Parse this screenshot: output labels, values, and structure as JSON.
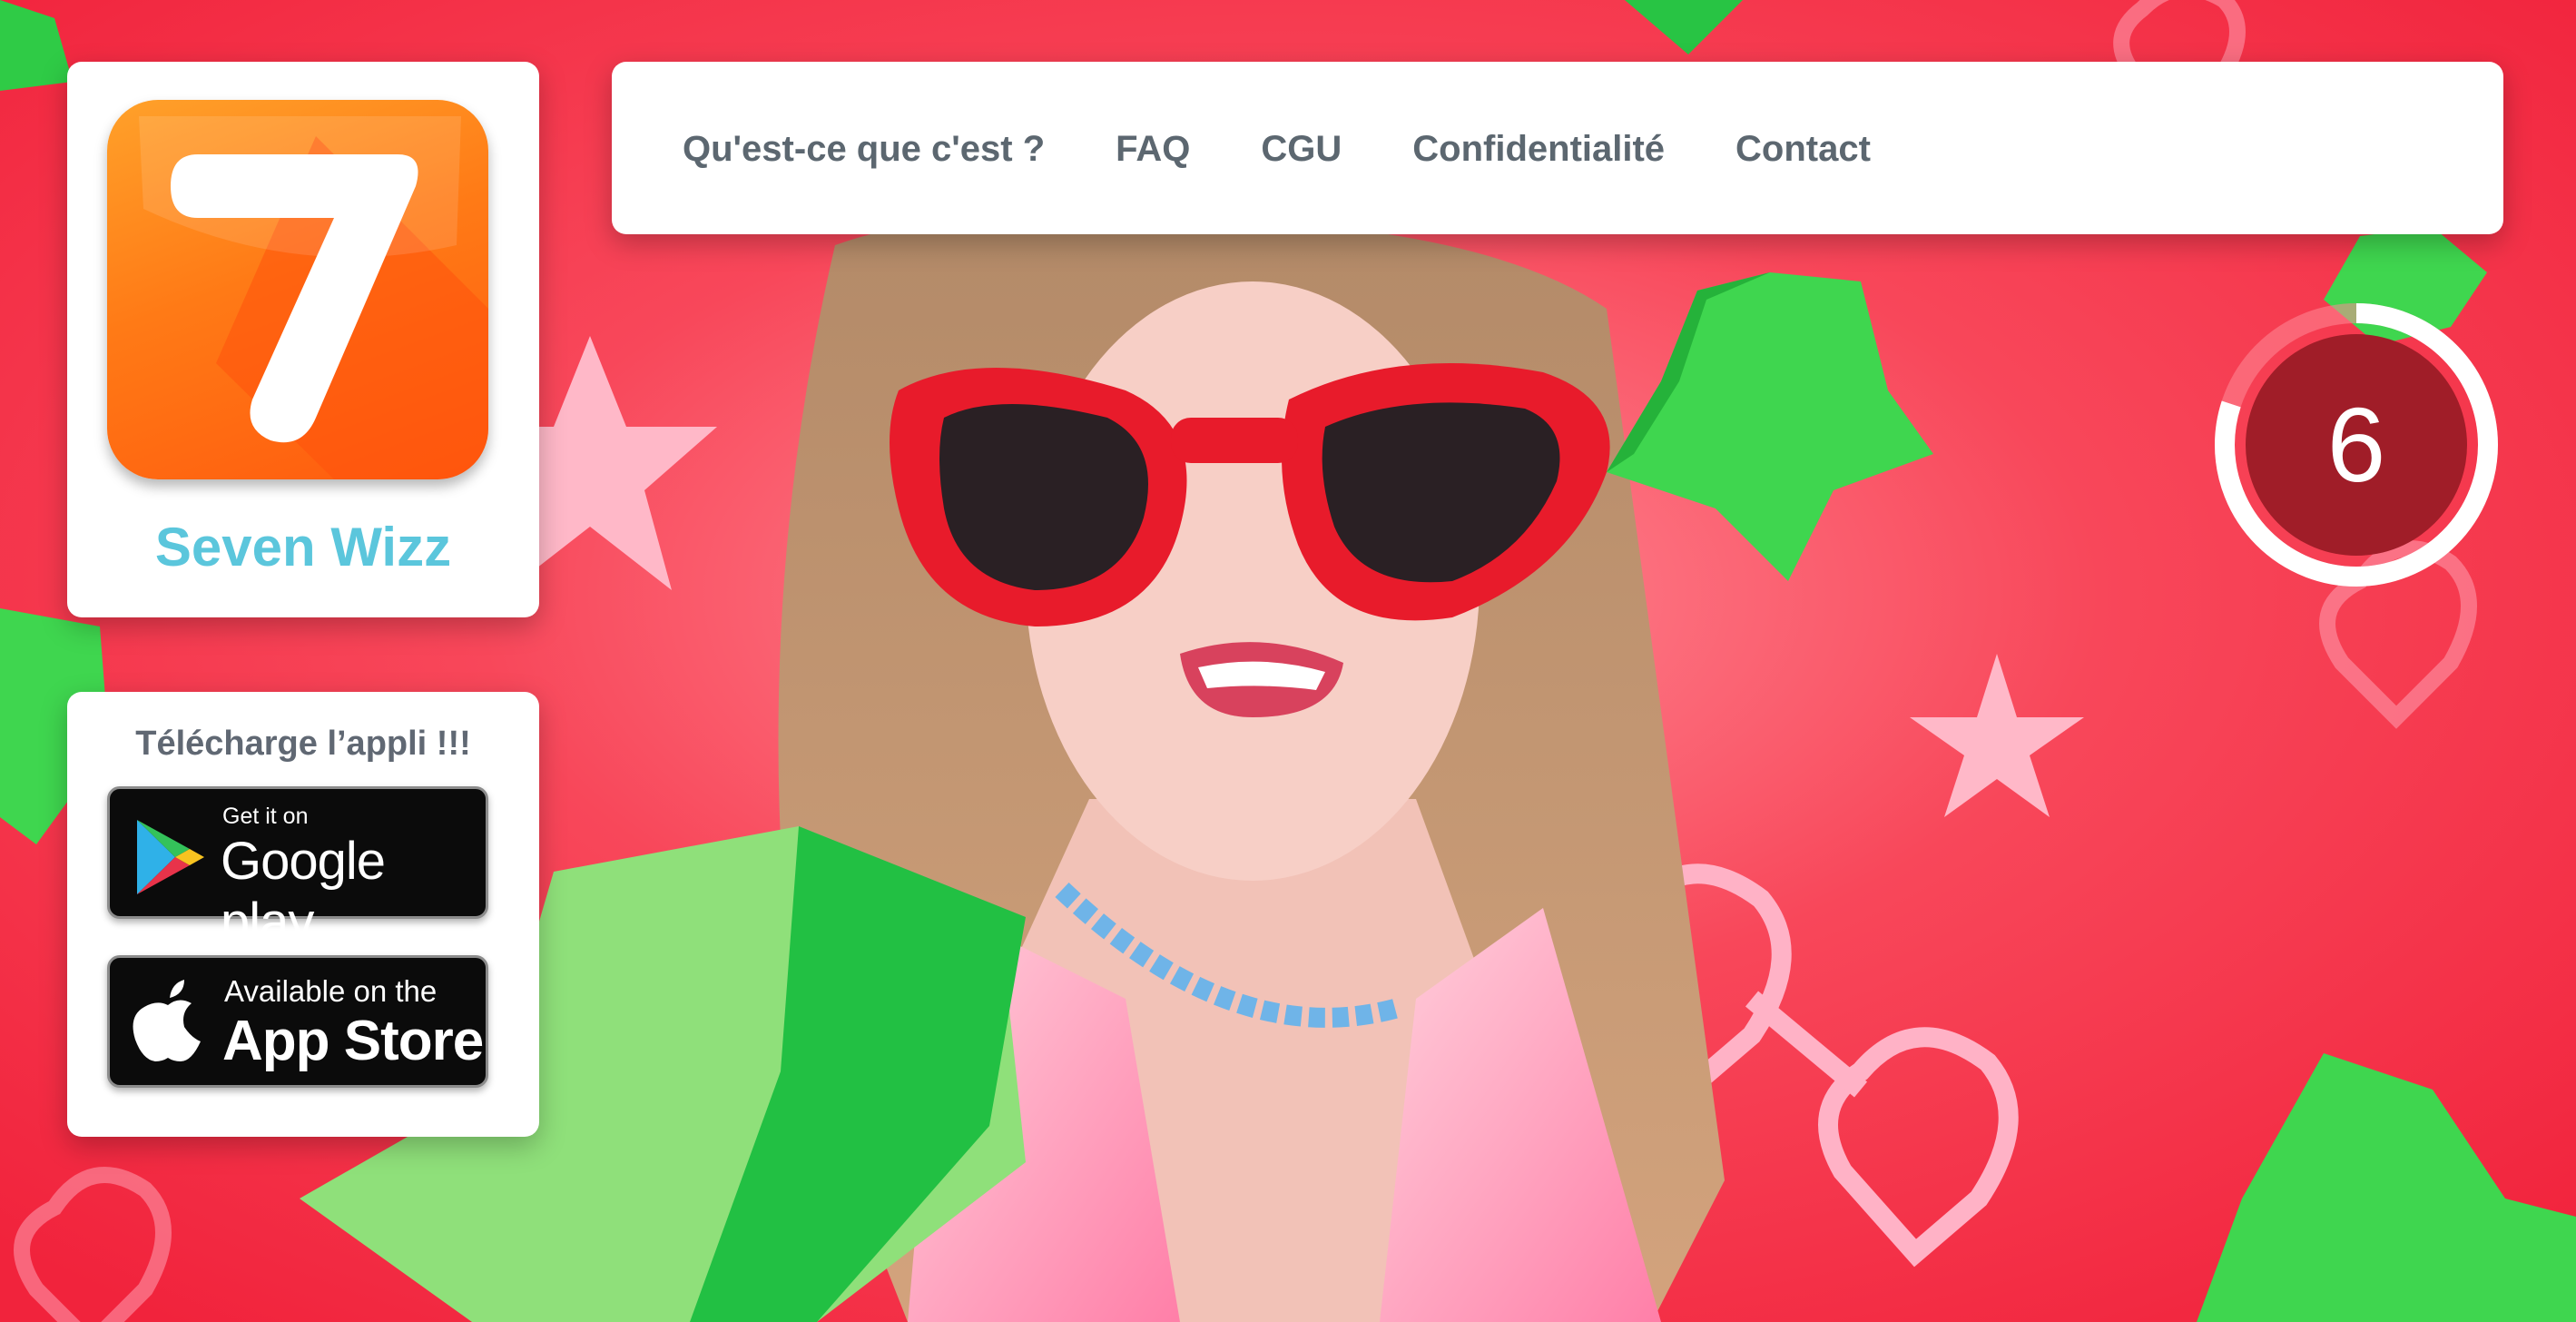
{
  "brand": {
    "app_icon_digit": "7",
    "name": "Seven Wizz"
  },
  "download": {
    "title": "Télécharge l’appli !!!",
    "google_play": {
      "small": "Get it on",
      "big": "Google play"
    },
    "app_store": {
      "small": "Available on the",
      "big": "App Store"
    }
  },
  "nav": {
    "items": [
      {
        "label": "Qu'est-ce que c'est ?"
      },
      {
        "label": "FAQ"
      },
      {
        "label": "CGU"
      },
      {
        "label": "Confidentialité"
      },
      {
        "label": "Contact"
      }
    ]
  },
  "timer": {
    "value": "6",
    "progress": 0.8
  },
  "colors": {
    "background_red": "#f4243f",
    "star_green": "#3fd64f",
    "brand_blue": "#5bc6dc",
    "nav_text": "#5c6770",
    "icon_orange": "#ff6a12",
    "timer_fill": "#a01d28"
  }
}
